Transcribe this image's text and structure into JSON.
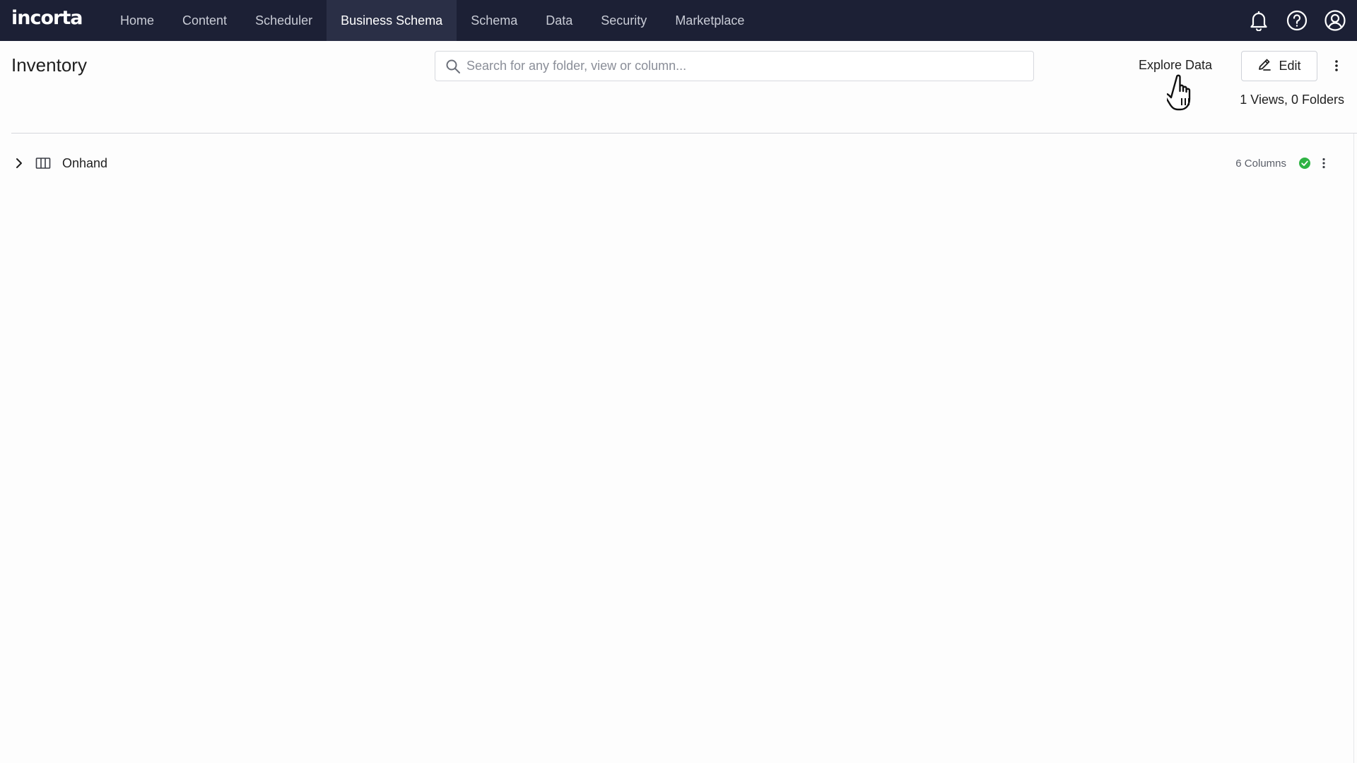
{
  "brand": {
    "logo_text": "incorta"
  },
  "nav": {
    "items": [
      {
        "label": "Home"
      },
      {
        "label": "Content"
      },
      {
        "label": "Scheduler"
      },
      {
        "label": "Business Schema"
      },
      {
        "label": "Schema"
      },
      {
        "label": "Data"
      },
      {
        "label": "Security"
      },
      {
        "label": "Marketplace"
      }
    ],
    "active_index": 3
  },
  "header_icons": [
    "bell-icon",
    "help-icon",
    "user-account-icon"
  ],
  "page": {
    "title": "Inventory",
    "search_placeholder": "Search for any folder, view or column...",
    "explore_label": "Explore Data",
    "edit_label": "Edit",
    "counts_text": "1 Views, 0 Folders"
  },
  "views": [
    {
      "name": "Onhand",
      "columns_text": "6 Columns",
      "status": "valid"
    }
  ],
  "colors": {
    "topbar": "#1c2035",
    "active_tab": "#2a2f46",
    "status_ok": "#2fb344"
  }
}
